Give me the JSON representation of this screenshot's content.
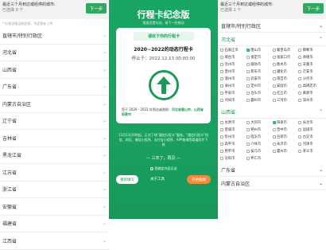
{
  "left": {
    "header_line1": "最近三个月到达或经停的城市:",
    "header_line2": "已选择 0 个",
    "next_label": "下一步",
    "hint": "* 行程仅限当前信息，不会保存上传",
    "provinces": [
      "直辖市/特别行政区",
      "河北省",
      "山西省",
      "广东省",
      "内蒙古自治区",
      "辽宁省",
      "吉林省",
      "黑龙江省",
      "江苏省",
      "浙江省",
      "安徽省",
      "福建省",
      "江西省"
    ]
  },
  "mid": {
    "title": "行程卡纪念版",
    "subtitle": "根据设置勾选，留下一些感动",
    "card_tab": "请收下你的行程卡",
    "card_title": "2020~2022的动态行程卡",
    "date_line": "停止于：2022.12.13 00:00:00",
    "foot_prefix": "您于 2020 - 2022 年到达或途经：",
    "foot_cities": "河北省唐山市、山西省阳泉市",
    "description": "12月13日0时起，正式下线“通信行程卡”服务。“通信行程卡”短信、网页、微信小程序、支付宝小程序、APP查询等渠道同步下线",
    "share": "— 三年了，再见 —",
    "agree": "我确定内容无误",
    "btn_rewrite": "重新填写",
    "btn_about": "关于工具",
    "btn_generate": "开始截图",
    "accent": "#1aa061"
  },
  "right": {
    "header_line1": "最近三个月到达或经停的城市:",
    "header_line2": "已选择 2 个",
    "next_label": "下一步",
    "top_province": "直辖市/特别行政区",
    "province_a": "河北省",
    "cities_a": [
      {
        "n": "石家庄市",
        "c": false
      },
      {
        "n": "唐山市",
        "c": true
      },
      {
        "n": "秦皇岛市",
        "c": false
      },
      {
        "n": "邯郸市",
        "c": false
      },
      {
        "n": "邢台市",
        "c": false
      },
      {
        "n": "保定市",
        "c": false
      },
      {
        "n": "张家口市",
        "c": false
      },
      {
        "n": "承德市",
        "c": false
      },
      {
        "n": "沧州市",
        "c": false
      },
      {
        "n": "廊坊市",
        "c": false
      },
      {
        "n": "衡水市",
        "c": false
      },
      {
        "n": "辛集市",
        "c": false
      },
      {
        "n": "晋州市",
        "c": false
      },
      {
        "n": "新乐市",
        "c": false
      },
      {
        "n": "遵化市",
        "c": false
      },
      {
        "n": "迁安市",
        "c": false
      },
      {
        "n": "滦州市",
        "c": false
      },
      {
        "n": "武安市",
        "c": false
      },
      {
        "n": "南宫市",
        "c": false
      },
      {
        "n": "沙河市",
        "c": false
      },
      {
        "n": "涿州市",
        "c": false
      },
      {
        "n": "定州市",
        "c": false
      },
      {
        "n": "安国市",
        "c": false
      },
      {
        "n": "高碑店市",
        "c": false
      },
      {
        "n": "平泉市",
        "c": false
      },
      {
        "n": "泊头市",
        "c": false
      },
      {
        "n": "任丘市",
        "c": false
      },
      {
        "n": "黄骅市",
        "c": false
      },
      {
        "n": "河间市",
        "c": false
      },
      {
        "n": "霸州市",
        "c": false
      },
      {
        "n": "三河市",
        "c": false
      },
      {
        "n": "深州市",
        "c": false
      }
    ],
    "province_b": "山西省",
    "cities_b": [
      {
        "n": "太原市",
        "c": false
      },
      {
        "n": "大同市",
        "c": false
      },
      {
        "n": "阳泉市",
        "c": true
      },
      {
        "n": "长治市",
        "c": false
      },
      {
        "n": "晋城市",
        "c": false
      },
      {
        "n": "朔州市",
        "c": false
      },
      {
        "n": "晋中市",
        "c": false
      },
      {
        "n": "运城市",
        "c": false
      },
      {
        "n": "忻州市",
        "c": false
      },
      {
        "n": "临汾市",
        "c": false
      },
      {
        "n": "吕梁市",
        "c": false
      },
      {
        "n": "古交市",
        "c": false
      },
      {
        "n": "高平市",
        "c": false
      },
      {
        "n": "介休市",
        "c": false
      },
      {
        "n": "永济市",
        "c": false
      },
      {
        "n": "河津市",
        "c": false
      },
      {
        "n": "原平市",
        "c": false
      },
      {
        "n": "侯马市",
        "c": false
      },
      {
        "n": "霍州市",
        "c": false
      },
      {
        "n": "孝义市",
        "c": false
      },
      {
        "n": "汾阳市",
        "c": false
      },
      {
        "n": "怀仁市",
        "c": false
      }
    ],
    "bottom_provinces": [
      "广东省",
      "内蒙古自治区"
    ]
  }
}
